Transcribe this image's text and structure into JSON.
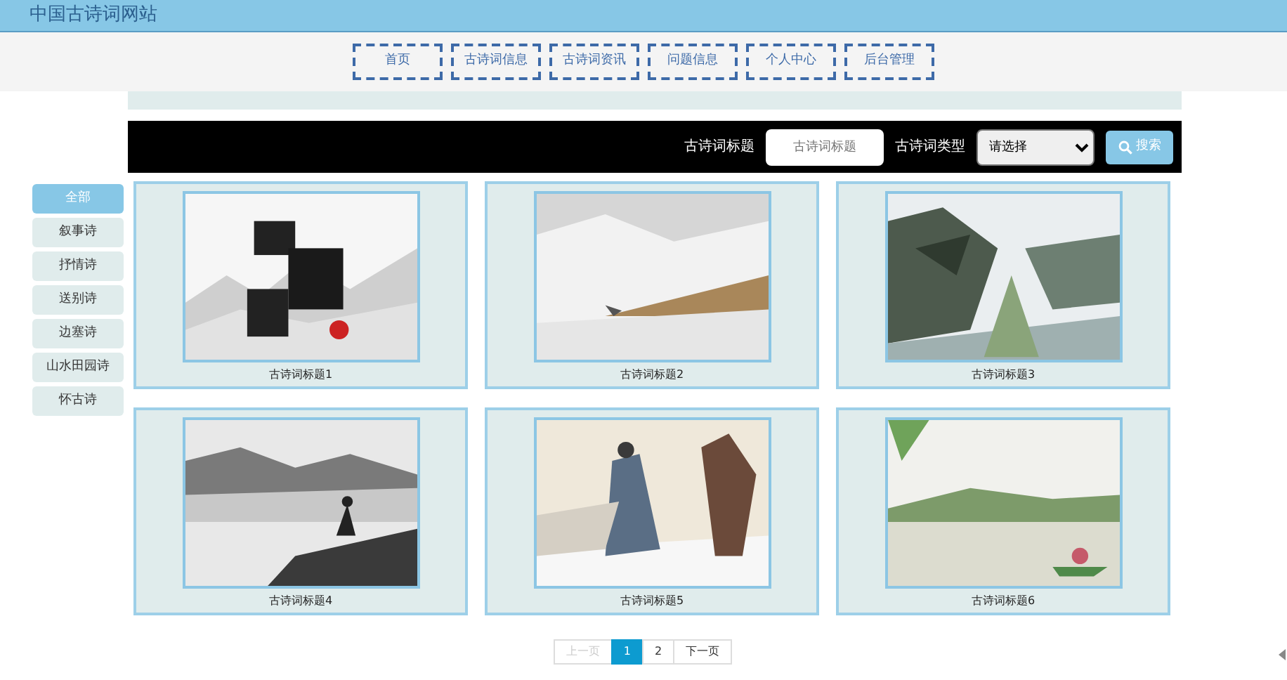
{
  "site_title": "中国古诗词网站",
  "nav": [
    {
      "label": "首页"
    },
    {
      "label": "古诗词信息"
    },
    {
      "label": "古诗词资讯"
    },
    {
      "label": "问题信息"
    },
    {
      "label": "个人中心"
    },
    {
      "label": "后台管理"
    }
  ],
  "search": {
    "title_label": "古诗词标题",
    "title_placeholder": "古诗词标题",
    "type_label": "古诗词类型",
    "type_value": "请选择",
    "button": "搜索"
  },
  "categories": [
    {
      "label": "全部",
      "selected": true
    },
    {
      "label": "叙事诗",
      "selected": false
    },
    {
      "label": "抒情诗",
      "selected": false
    },
    {
      "label": "送别诗",
      "selected": false
    },
    {
      "label": "边塞诗",
      "selected": false
    },
    {
      "label": "山水田园诗",
      "selected": false
    },
    {
      "label": "怀古诗",
      "selected": false
    }
  ],
  "items": [
    {
      "kind": "picture",
      "title": "古诗词标题1"
    },
    {
      "kind": "picture",
      "title": "古诗词标题2"
    },
    {
      "kind": "picture",
      "title": "古诗词标题3"
    },
    {
      "kind": "picture",
      "title": "古诗词标题4"
    },
    {
      "kind": "picture",
      "title": "古诗词标题5"
    },
    {
      "kind": "picture",
      "title": "古诗词标题6"
    }
  ],
  "pagination": [
    {
      "label": "上一页",
      "disabled": true,
      "selected": false
    },
    {
      "label": "1",
      "disabled": false,
      "selected": true
    },
    {
      "label": "2",
      "disabled": false,
      "selected": false
    },
    {
      "label": "下一页",
      "disabled": false,
      "selected": false
    }
  ]
}
